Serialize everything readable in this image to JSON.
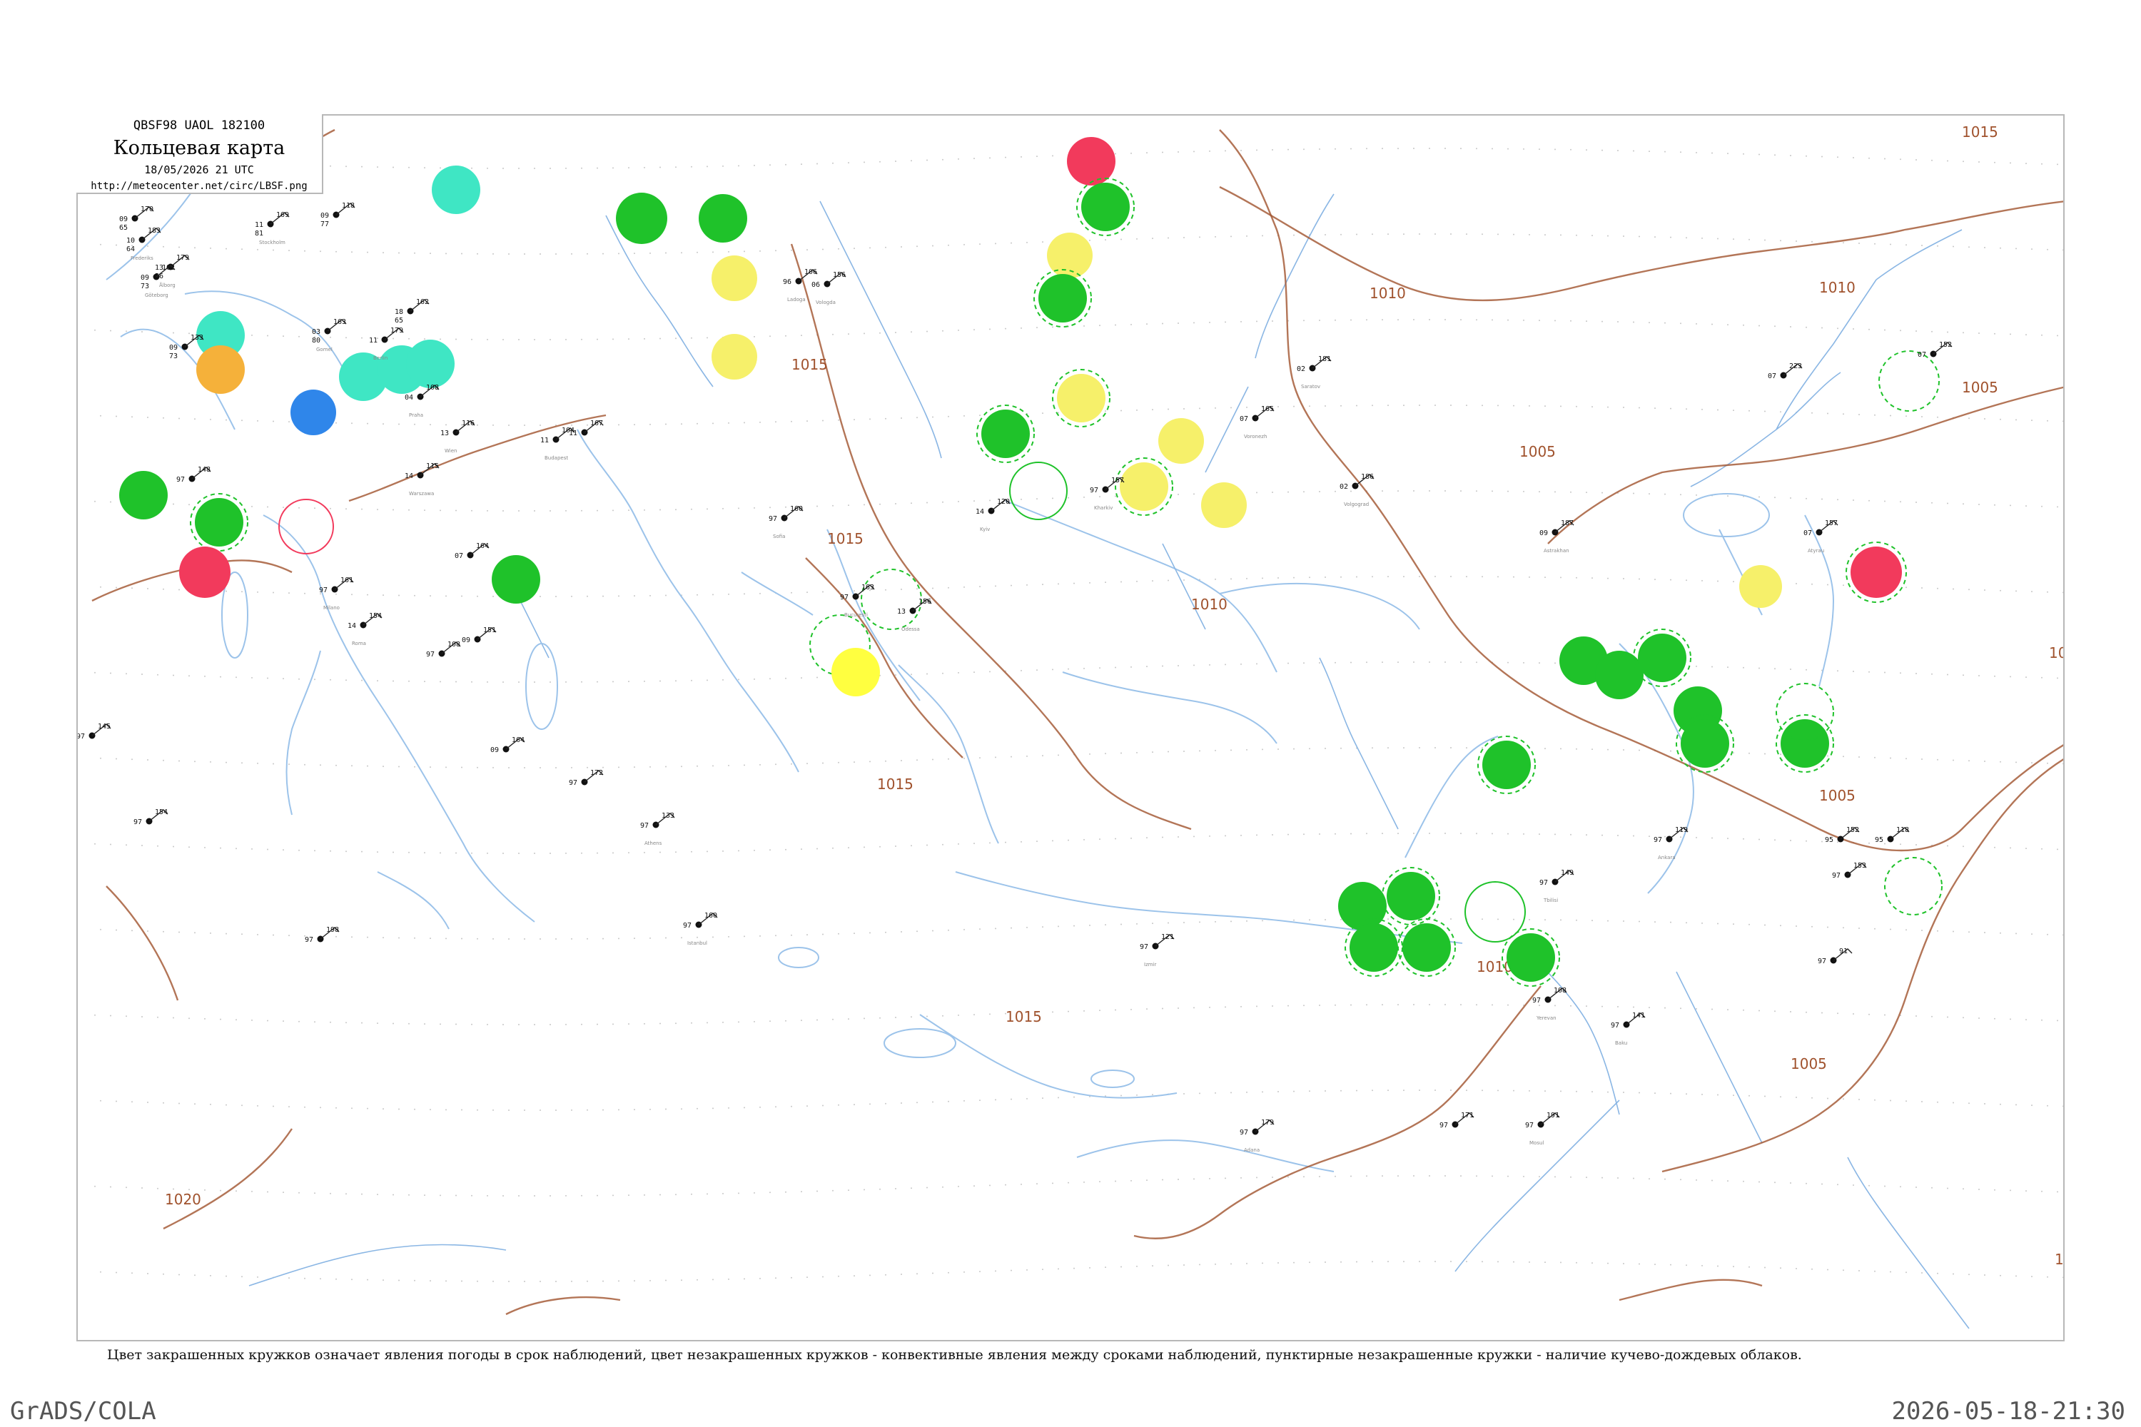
{
  "header": {
    "code_line": "QBSF98  UAOL  182100",
    "title": "Кольцевая карта",
    "datetime": "18/05/2026 21 UTC",
    "url": "http://meteocenter.net/circ/LBSF.png"
  },
  "caption": "Цвет закрашенных кружков означает явления погоды в срок наблюдений, цвет незакрашенных кружков - конвективные явления между сроками наблюдений, пунктирные незакрашенные кружки - наличие кучево-дождевых облаков.",
  "footer": {
    "software": "GrADS/COLA",
    "timestamp": "2026-05-18-21:30"
  },
  "colors": {
    "rain_green": "#1fc22a",
    "shower_cyan": "#3fe6c4",
    "drizzle_yellow": "#f6f06a",
    "fog_yellow": "#ffff40",
    "thunder_red": "#f23a5c",
    "snow_blue": "#2f86ea",
    "haze_orange": "#f5b13a",
    "isobar_brown": "#a0522d",
    "coast_blue": "#9cc3ea"
  },
  "isobars": [
    {
      "label": "1015"
    },
    {
      "label": "1010"
    },
    {
      "label": "1010"
    },
    {
      "label": "1005"
    },
    {
      "label": "1005"
    },
    {
      "label": "1015"
    },
    {
      "label": "1010"
    },
    {
      "label": "1015"
    },
    {
      "label": "1010"
    },
    {
      "label": "1005"
    },
    {
      "label": "1005"
    },
    {
      "label": "1015"
    },
    {
      "label": "1020"
    },
    {
      "label": "10"
    },
    {
      "label": "1"
    },
    {
      "label": "1015"
    }
  ],
  "stations": [
    {
      "t": "170",
      "p": "09",
      "d": "65",
      "name": ""
    },
    {
      "t": "183",
      "p": "10",
      "d": "64",
      "name": "Frederiks"
    },
    {
      "t": "179",
      "p": "13",
      "d": "56",
      "name": "Ålborg"
    },
    {
      "t": "102",
      "p": "09",
      "d": "73",
      "name": "Göteborg"
    },
    {
      "t": "169",
      "p": "11",
      "d": "81",
      "name": "Stockholm"
    },
    {
      "t": "118",
      "p": "09",
      "d": "77",
      "name": ""
    },
    {
      "t": "161",
      "p": "01",
      "d": "65",
      "name": "Helsinki"
    },
    {
      "t": "106",
      "p": "96",
      "d": "",
      "name": "Ladoga"
    },
    {
      "t": "156",
      "p": "06",
      "d": "",
      "name": "Vologda"
    },
    {
      "t": "162",
      "p": "18",
      "d": "65",
      "name": ""
    },
    {
      "t": "133",
      "p": "09",
      "d": "73",
      "name": ""
    },
    {
      "t": "163",
      "p": "03",
      "d": "80",
      "name": "Gomel"
    },
    {
      "t": "115",
      "p": "14",
      "d": "",
      "name": "Warszawa"
    },
    {
      "t": "179",
      "p": "11",
      "d": "",
      "name": "Berlin"
    },
    {
      "t": "108",
      "p": "04",
      "d": "",
      "name": "Praha"
    },
    {
      "t": "116",
      "p": "13",
      "d": "",
      "name": "Wien"
    },
    {
      "t": "104",
      "p": "11",
      "d": "",
      "name": "Budapest"
    },
    {
      "t": "167",
      "p": "11",
      "d": "",
      "name": ""
    },
    {
      "t": "164",
      "p": "07",
      "d": "",
      "name": ""
    },
    {
      "t": "161",
      "p": "97",
      "d": "",
      "name": "Milano"
    },
    {
      "t": "154",
      "p": "14",
      "d": "",
      "name": "Roma"
    },
    {
      "t": "151",
      "p": "09",
      "d": "",
      "name": ""
    },
    {
      "t": "108",
      "p": "97",
      "d": "",
      "name": ""
    },
    {
      "t": "164",
      "p": "09",
      "d": "",
      "name": ""
    },
    {
      "t": "172",
      "p": "97",
      "d": "",
      "name": ""
    },
    {
      "t": "133",
      "p": "97",
      "d": "",
      "name": "Athens"
    },
    {
      "t": "160",
      "p": "97",
      "d": "",
      "name": "Sofia"
    },
    {
      "t": "163",
      "p": "97",
      "d": "",
      "name": "Bucuresti"
    },
    {
      "t": "156",
      "p": "13",
      "d": "",
      "name": "Odessa"
    },
    {
      "t": "120",
      "p": "14",
      "d": "",
      "name": "Kyiv"
    },
    {
      "t": "157",
      "p": "97",
      "d": "",
      "name": "Kharkiv"
    },
    {
      "t": "165",
      "p": "07",
      "d": "",
      "name": "Voronezh"
    },
    {
      "t": "181",
      "p": "02",
      "d": "",
      "name": "Saratov"
    },
    {
      "t": "186",
      "p": "02",
      "d": "",
      "name": "Volgograd"
    },
    {
      "t": "187",
      "p": "09",
      "d": "",
      "name": "Astrakhan"
    },
    {
      "t": "157",
      "p": "07",
      "d": "",
      "name": "Atyrau"
    },
    {
      "t": "223",
      "p": "07",
      "d": "",
      "name": ""
    },
    {
      "t": "152",
      "p": "07",
      "d": "",
      "name": ""
    },
    {
      "t": "149",
      "p": "97",
      "d": "",
      "name": "Tbilisi"
    },
    {
      "t": "108",
      "p": "97",
      "d": "",
      "name": "Yerevan"
    },
    {
      "t": "141",
      "p": "97",
      "d": "",
      "name": "Baku"
    },
    {
      "t": "119",
      "p": "97",
      "d": "",
      "name": "Ankara"
    },
    {
      "t": "121",
      "p": "97",
      "d": "",
      "name": "Izmir"
    },
    {
      "t": "160",
      "p": "97",
      "d": "",
      "name": "Istanbul"
    },
    {
      "t": "179",
      "p": "97",
      "d": "",
      "name": "Adana"
    },
    {
      "t": "171",
      "p": "97",
      "d": "",
      "name": ""
    },
    {
      "t": "191",
      "p": "97",
      "d": "",
      "name": "Mosul"
    },
    {
      "t": "152",
      "p": "95",
      "d": "",
      "name": ""
    },
    {
      "t": "118",
      "p": "95",
      "d": "",
      "name": ""
    },
    {
      "t": "153",
      "p": "97",
      "d": "",
      "name": ""
    },
    {
      "t": "91",
      "p": "97",
      "d": "",
      "name": ""
    },
    {
      "t": "148",
      "p": "97",
      "d": "",
      "name": ""
    },
    {
      "t": "198",
      "p": "97",
      "d": "",
      "name": ""
    },
    {
      "t": "154",
      "p": "97",
      "d": "",
      "name": ""
    },
    {
      "t": "145",
      "p": "97",
      "d": "",
      "name": ""
    }
  ]
}
